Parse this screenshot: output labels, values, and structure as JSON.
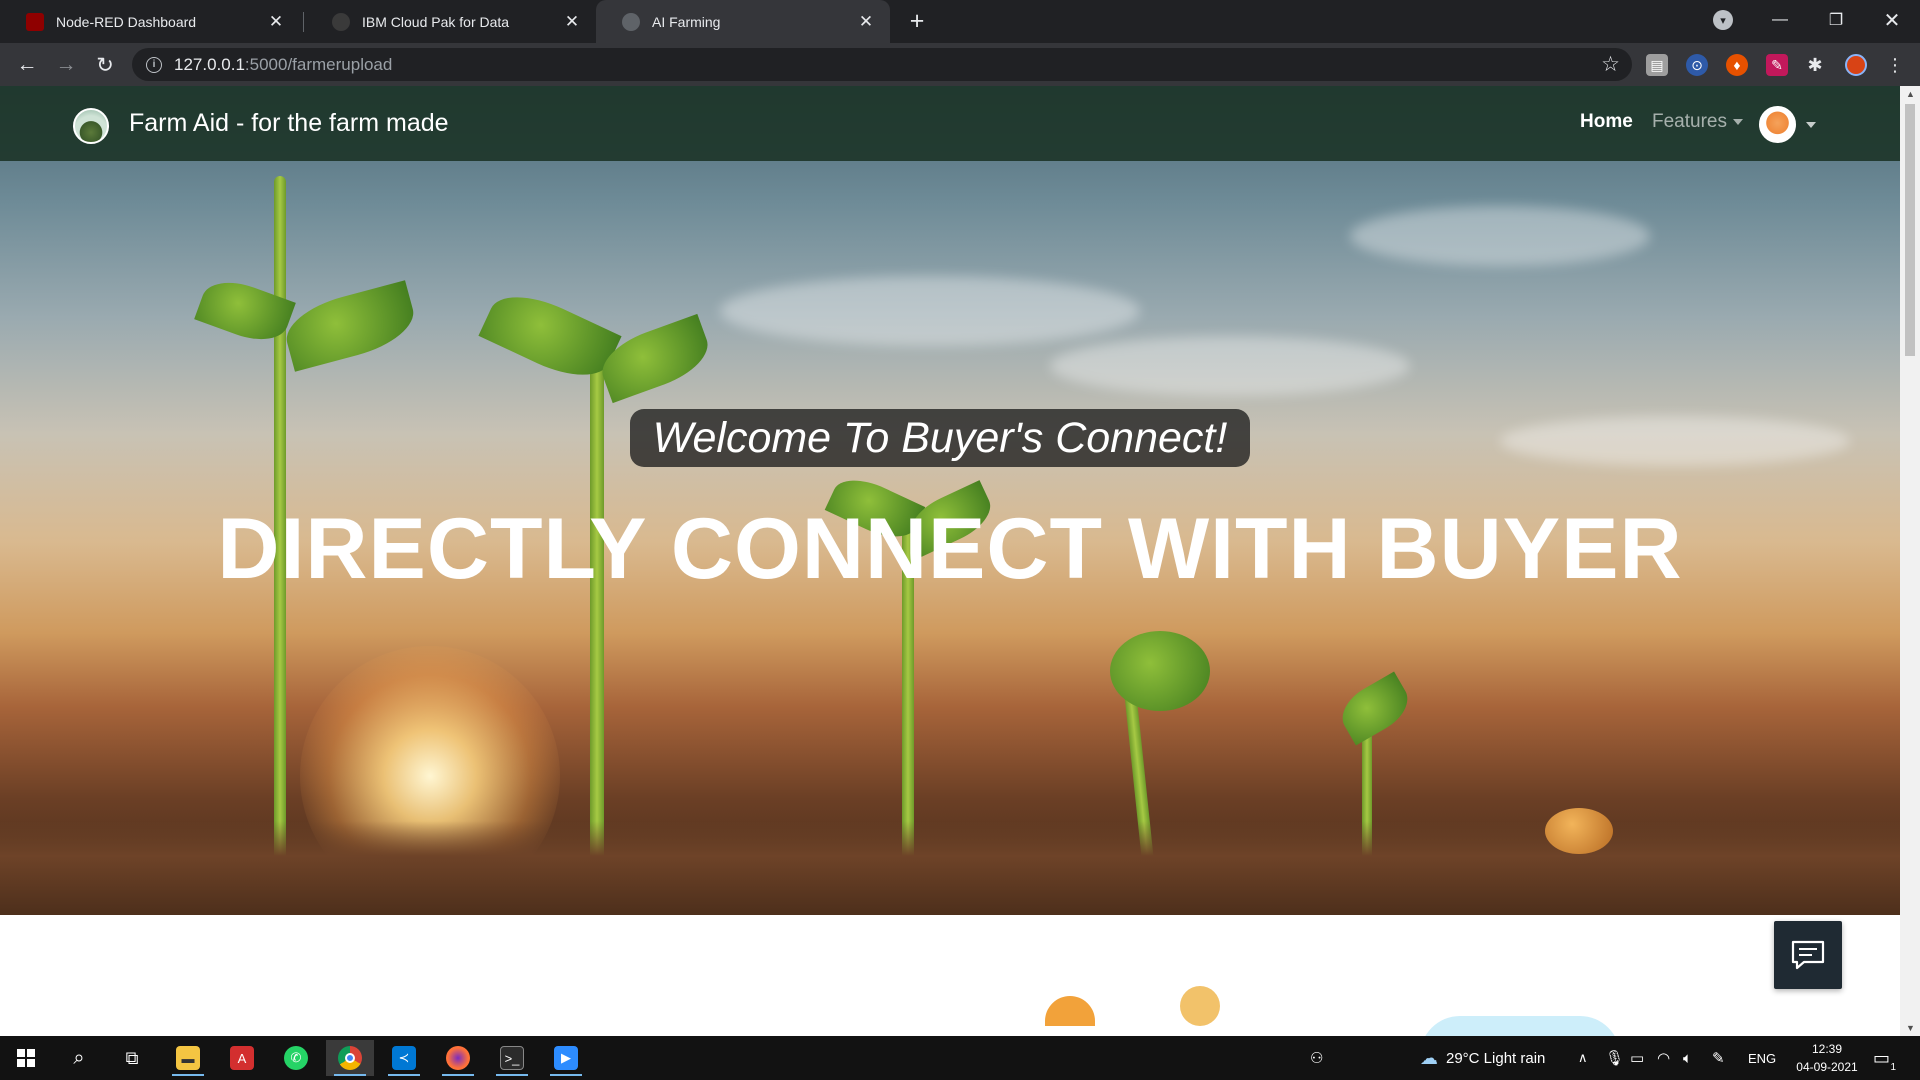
{
  "browser": {
    "tabs": [
      {
        "title": "Node-RED Dashboard",
        "favicon_color": "#8f0000"
      },
      {
        "title": "IBM Cloud Pak for Data",
        "favicon_color": "#3a3a3a"
      },
      {
        "title": "AI Farming",
        "favicon_color": "#5f6368"
      }
    ],
    "url": {
      "host": "127.0.0.1",
      "path": ":5000/farmerupload"
    }
  },
  "navbar": {
    "brand": "Farm Aid - for the farm made",
    "home": "Home",
    "features": "Features"
  },
  "hero": {
    "welcome": "Welcome To Buyer's Connect!",
    "title": "DIRECTLY CONNECT WITH BUYER"
  },
  "taskbar": {
    "weather": "29°C  Light rain",
    "language": "ENG",
    "time": "12:39",
    "date": "04-09-2021",
    "notification_count": "1"
  },
  "colors": {
    "navbar_bg": "#1a3224",
    "chrome_dark": "#202124",
    "chrome_toolbar": "#35363a"
  }
}
